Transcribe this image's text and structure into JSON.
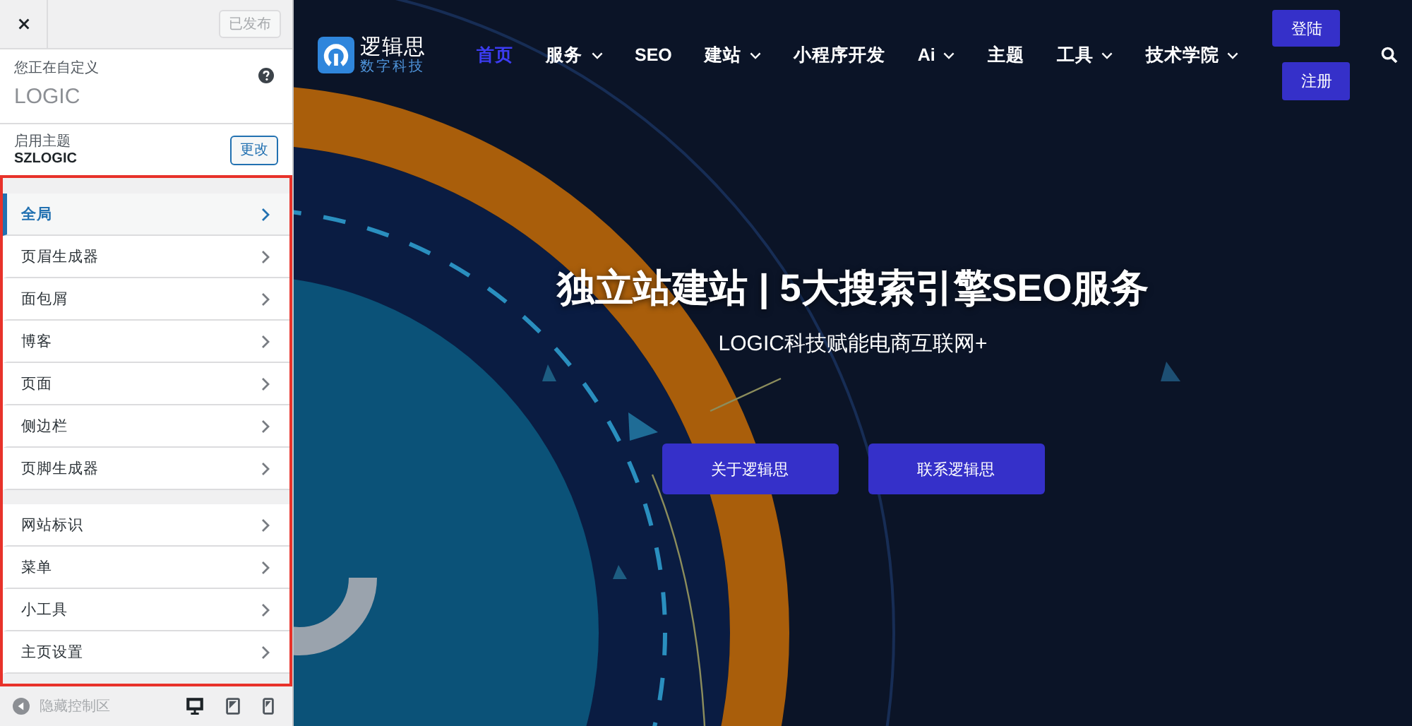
{
  "customizer": {
    "publish_button": {
      "label": "已发布",
      "disabled": true
    },
    "info": {
      "caption": "您正在自定义",
      "site_name": "LOGIC"
    },
    "theme": {
      "caption": "启用主题",
      "name": "SZLOGIC",
      "change_button": "更改"
    },
    "sections": [
      {
        "items": [
          {
            "label": "全局",
            "selected": true
          },
          {
            "label": "页眉生成器",
            "selected": false
          },
          {
            "label": "面包屑",
            "selected": false
          },
          {
            "label": "博客",
            "selected": false
          },
          {
            "label": "页面",
            "selected": false
          },
          {
            "label": "侧边栏",
            "selected": false
          },
          {
            "label": "页脚生成器",
            "selected": false
          }
        ]
      },
      {
        "items": [
          {
            "label": "网站标识",
            "selected": false
          },
          {
            "label": "菜单",
            "selected": false
          },
          {
            "label": "小工具",
            "selected": false
          },
          {
            "label": "主页设置",
            "selected": false
          }
        ]
      }
    ],
    "footer": {
      "collapse_label": "隐藏控制区",
      "devices": [
        {
          "kind": "desktop",
          "selected": true
        },
        {
          "kind": "tablet",
          "selected": false
        },
        {
          "kind": "mobile",
          "selected": false
        }
      ]
    }
  },
  "preview": {
    "logo": {
      "name": "逻辑思",
      "tagline": "数字科技"
    },
    "nav": [
      {
        "label": "首页",
        "selected": true,
        "dropdown": false
      },
      {
        "label": "服务",
        "selected": false,
        "dropdown": true
      },
      {
        "label": "SEO",
        "selected": false,
        "dropdown": false
      },
      {
        "label": "建站",
        "selected": false,
        "dropdown": true
      },
      {
        "label": "小程序开发",
        "selected": false,
        "dropdown": false
      },
      {
        "label": "Ai",
        "selected": false,
        "dropdown": true
      },
      {
        "label": "主题",
        "selected": false,
        "dropdown": false
      },
      {
        "label": "工具",
        "selected": false,
        "dropdown": true
      },
      {
        "label": "技术学院",
        "selected": false,
        "dropdown": true
      }
    ],
    "auth_buttons": [
      "登陆",
      "注册"
    ],
    "hero": {
      "title": "独立站建站 | 5大搜索引擎SEO服务",
      "subtitle": "LOGIC科技赋能电商互联网+",
      "buttons": [
        "关于逻辑思",
        "联系逻辑思"
      ]
    }
  }
}
